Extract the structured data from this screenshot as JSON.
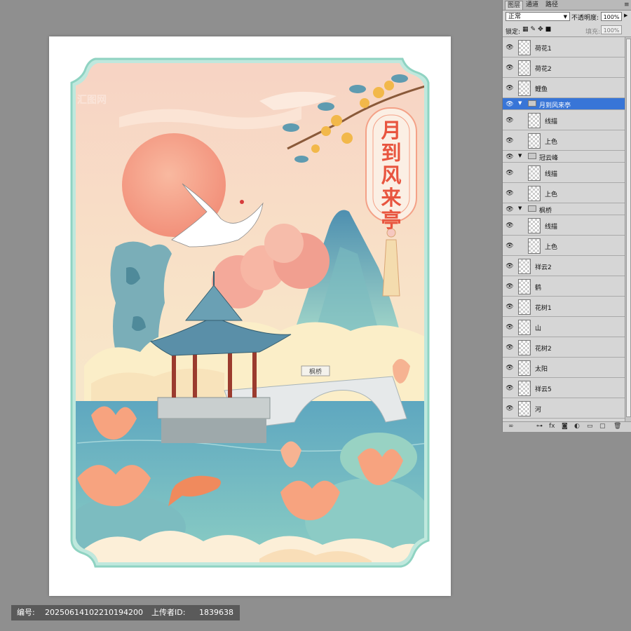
{
  "panel": {
    "tabs": [
      "图层",
      "通道",
      "路径"
    ],
    "blend_mode": "正常",
    "opacity_label": "不透明度:",
    "opacity_value": "100%",
    "lock_label": "锁定:",
    "fill_label": "填充:",
    "fill_value": "100%",
    "layers": [
      {
        "name": "荷花1",
        "type": "layer",
        "indent": 0,
        "selected": false
      },
      {
        "name": "荷花2",
        "type": "layer",
        "indent": 0,
        "selected": false
      },
      {
        "name": "鲤鱼",
        "type": "layer",
        "indent": 0,
        "selected": false
      },
      {
        "name": "月到风来亭",
        "type": "group",
        "indent": 0,
        "selected": true
      },
      {
        "name": "线描",
        "type": "layer",
        "indent": 1,
        "selected": false
      },
      {
        "name": "上色",
        "type": "layer",
        "indent": 1,
        "selected": false
      },
      {
        "name": "冠云峰",
        "type": "group",
        "indent": 0,
        "selected": false
      },
      {
        "name": "线描",
        "type": "layer",
        "indent": 1,
        "selected": false
      },
      {
        "name": "上色",
        "type": "layer",
        "indent": 1,
        "selected": false
      },
      {
        "name": "枫桥",
        "type": "group",
        "indent": 0,
        "selected": false
      },
      {
        "name": "线描",
        "type": "layer",
        "indent": 1,
        "selected": false
      },
      {
        "name": "上色",
        "type": "layer",
        "indent": 1,
        "selected": false
      },
      {
        "name": "祥云2",
        "type": "layer",
        "indent": 0,
        "selected": false
      },
      {
        "name": "鹤",
        "type": "layer",
        "indent": 0,
        "selected": false
      },
      {
        "name": "花树1",
        "type": "layer",
        "indent": 0,
        "selected": false
      },
      {
        "name": "山",
        "type": "layer",
        "indent": 0,
        "selected": false
      },
      {
        "name": "花树2",
        "type": "layer",
        "indent": 0,
        "selected": false
      },
      {
        "name": "太阳",
        "type": "layer",
        "indent": 0,
        "selected": false
      },
      {
        "name": "祥云5",
        "type": "layer",
        "indent": 0,
        "selected": false
      },
      {
        "name": "河",
        "type": "layer",
        "indent": 0,
        "selected": false
      }
    ]
  },
  "artwork": {
    "vertical_title": "月到风来亭",
    "bridge_plaque": "枫桥"
  },
  "caption": {
    "id_label": "编号:",
    "id_value": "20250614102210194200",
    "uploader_label": "上传者ID:",
    "uploader_value": "1839638"
  },
  "colors": {
    "frame": "#8fd3c2",
    "sky": "#f6d8c8",
    "sun": "#f4a187",
    "water": "#6fb8c4",
    "selection": "#3875d7",
    "title_text": "#e8553f"
  }
}
